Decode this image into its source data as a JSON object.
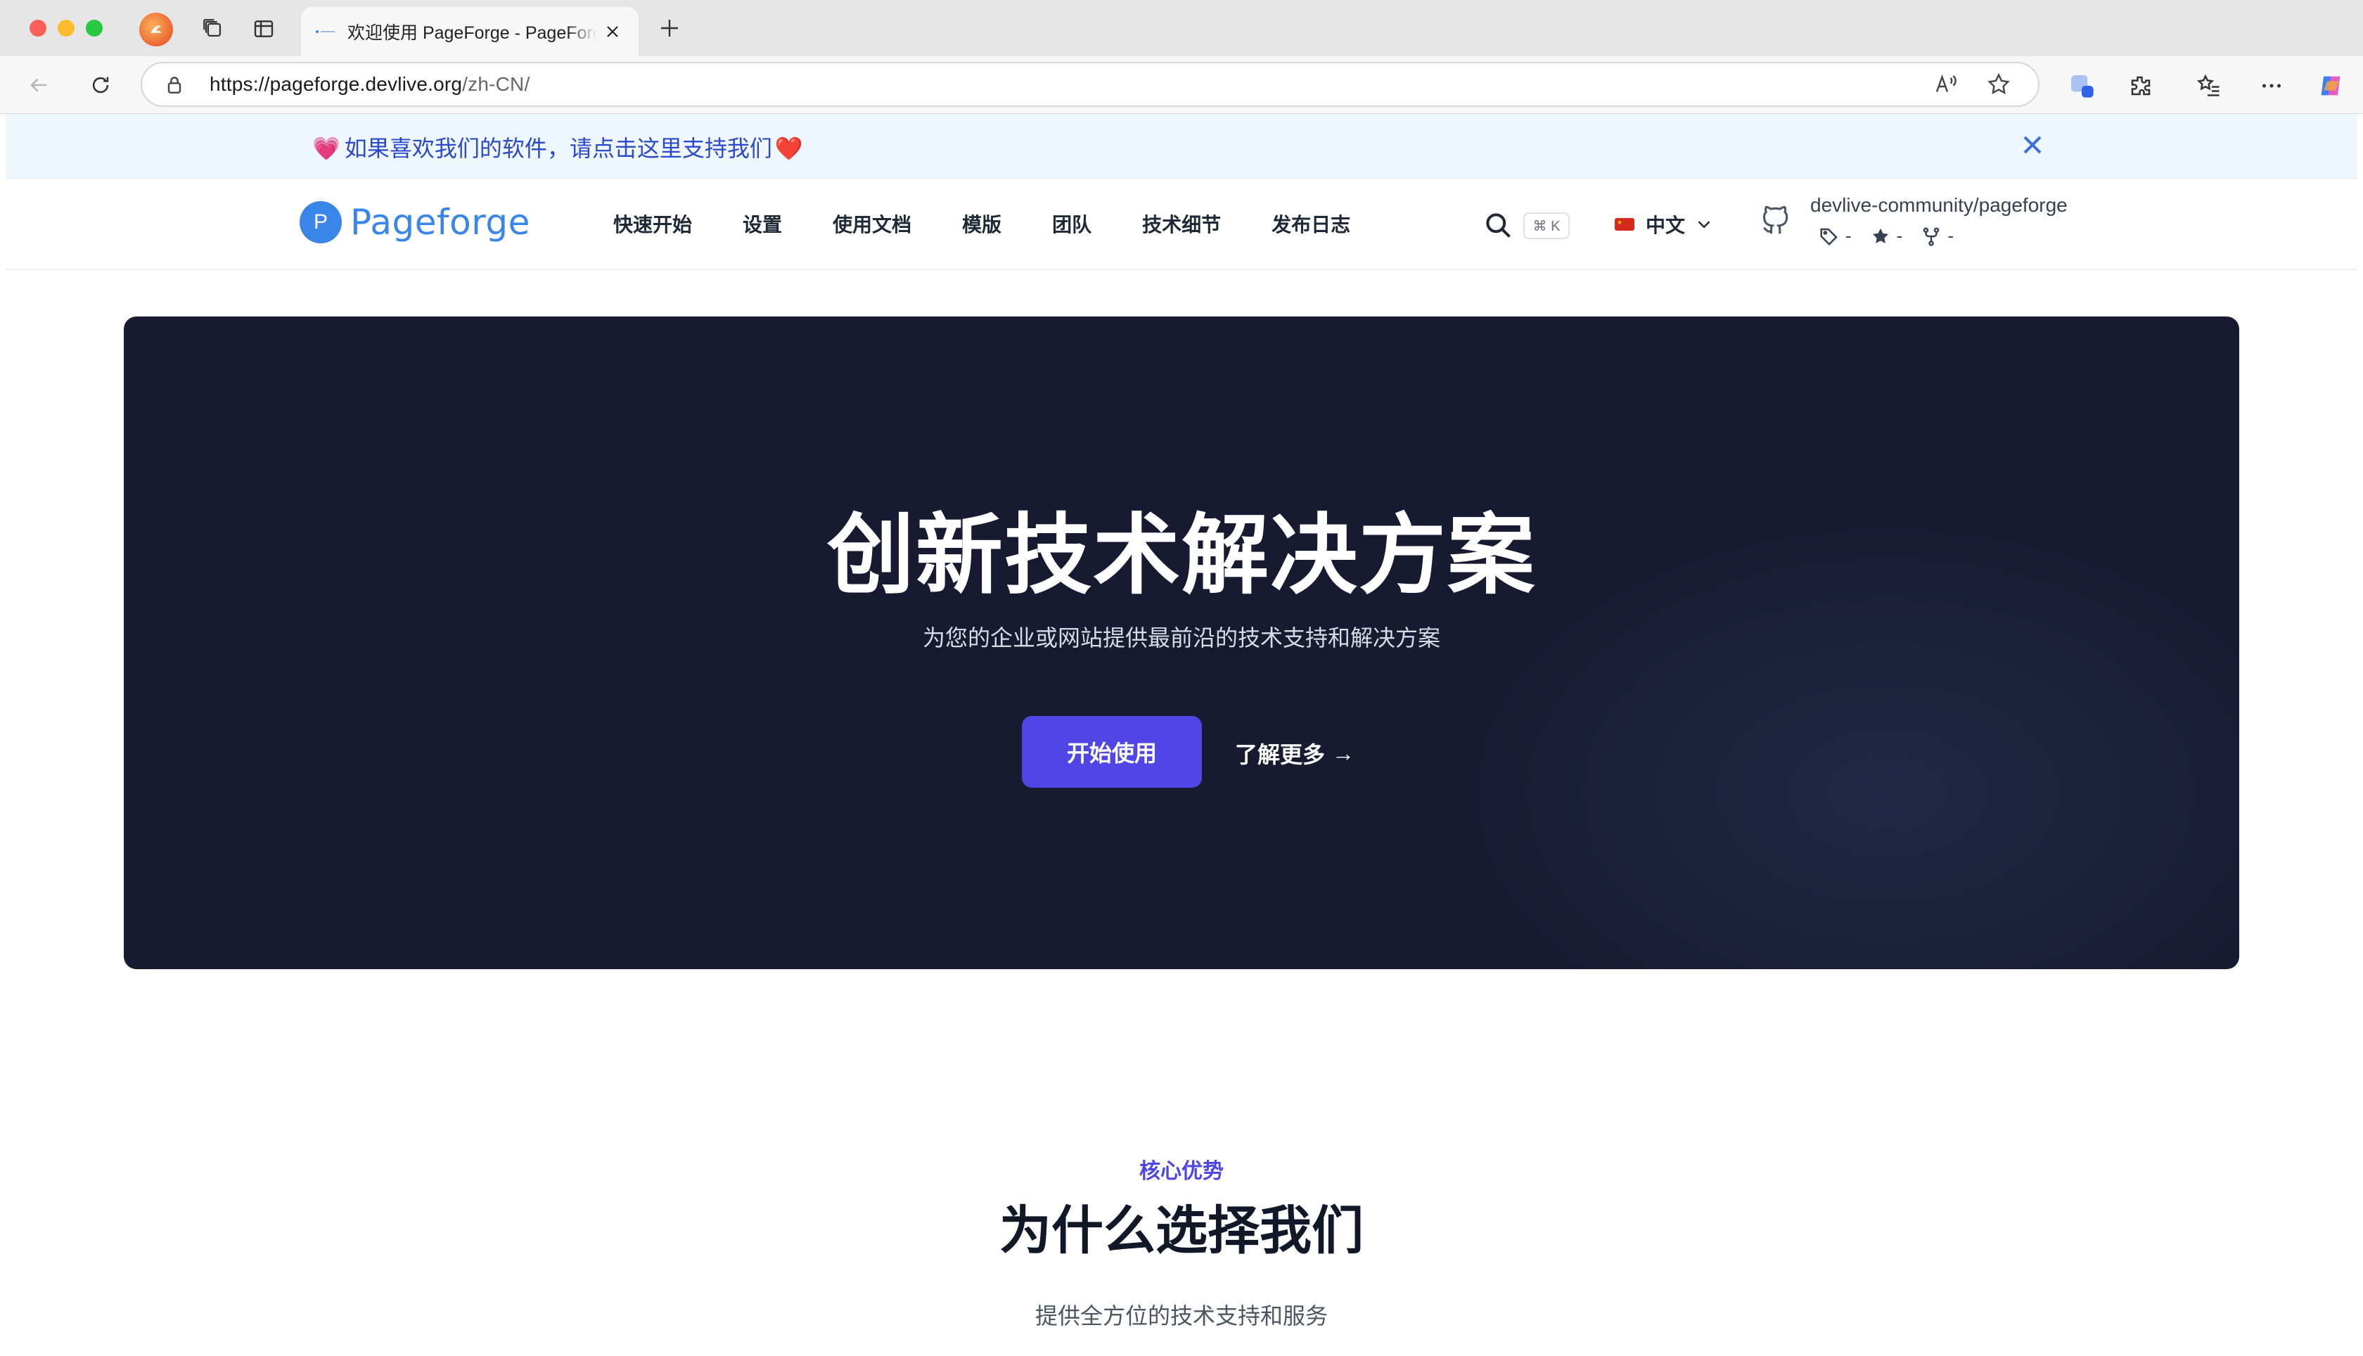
{
  "browser": {
    "tab_title": "欢迎使用 PageForge - PageForge",
    "url_host": "https://pageforge.devlive.org",
    "url_path": "/zh-CN/"
  },
  "banner": {
    "heart_left": "💗",
    "text": "如果喜欢我们的软件，请点击这里支持我们",
    "heart_right": "❤️"
  },
  "navbar": {
    "logo_letter": "P",
    "logo_text": "Pageforge",
    "menu": [
      "快速开始",
      "设置",
      "使用文档",
      "模版",
      "团队",
      "技术细节",
      "发布日志"
    ],
    "search_shortcut": "⌘ K",
    "language": "中文",
    "repo": {
      "name": "devlive-community/pageforge",
      "tags": "-",
      "stars": "-",
      "forks": "-"
    }
  },
  "hero": {
    "title": "创新技术解决方案",
    "subtitle": "为您的企业或网站提供最前沿的技术支持和解决方案",
    "primary_button": "开始使用",
    "secondary_link": "了解更多",
    "secondary_arrow": "→"
  },
  "features": {
    "kicker": "核心优势",
    "title": "为什么选择我们",
    "subtitle": "提供全方位的技术支持和服务"
  },
  "colors": {
    "accent": "#4f46e5",
    "brand": "#3a86e8",
    "hero_bg": "#171a30",
    "banner_bg": "#eef6ff"
  }
}
